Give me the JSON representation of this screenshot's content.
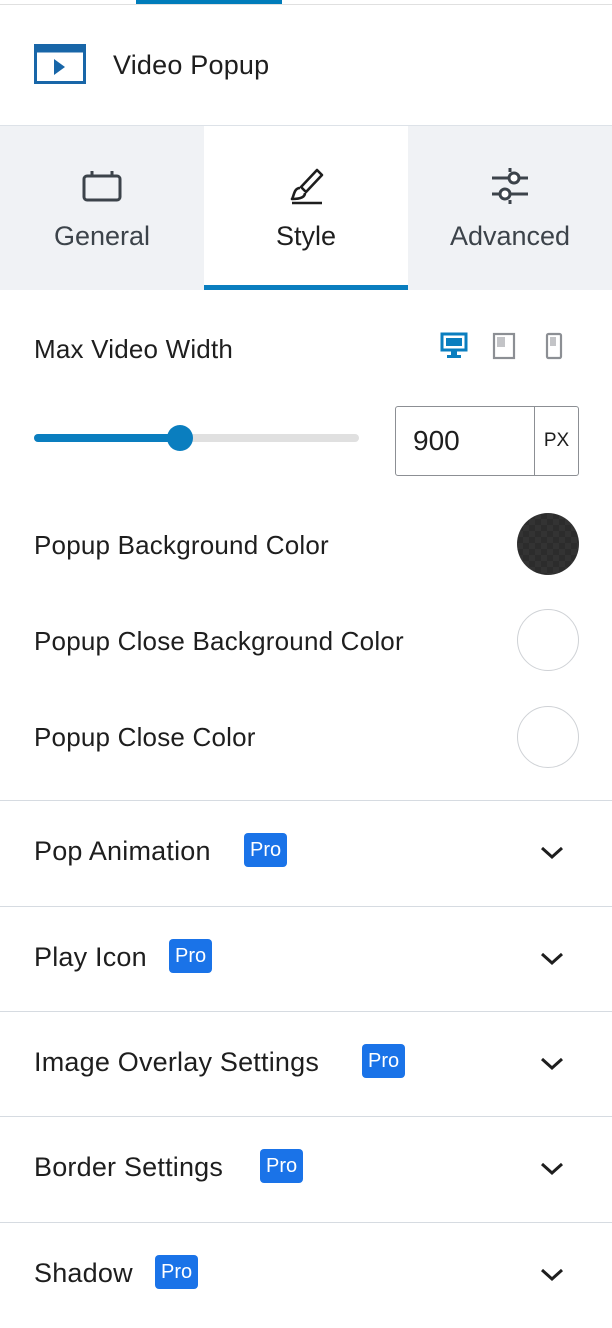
{
  "block": {
    "title": "Video Popup",
    "icon": "video-player-icon"
  },
  "tabs": [
    {
      "label": "General",
      "icon": "general-icon",
      "active": false
    },
    {
      "label": "Style",
      "icon": "brush-icon",
      "active": true
    },
    {
      "label": "Advanced",
      "icon": "sliders-icon",
      "active": false
    }
  ],
  "max_width": {
    "label": "Max Video Width",
    "value": "900",
    "unit": "PX",
    "slider_fraction": 0.45,
    "devices": [
      "desktop-icon",
      "tablet-icon",
      "mobile-icon"
    ]
  },
  "colors": [
    {
      "label": "Popup Background Color",
      "value": "#2c2c2c"
    },
    {
      "label": "Popup Close Background Color",
      "value": ""
    },
    {
      "label": "Popup Close Color",
      "value": ""
    }
  ],
  "panels": [
    {
      "title": "Pop Animation",
      "badge": "Pro"
    },
    {
      "title": "Play Icon",
      "badge": "Pro"
    },
    {
      "title": "Image Overlay Settings",
      "badge": "Pro"
    },
    {
      "title": "Border Settings",
      "badge": "Pro"
    },
    {
      "title": "Shadow",
      "badge": "Pro"
    }
  ],
  "accent_color": "#0a7ebf",
  "badge_color": "#1a73e8"
}
